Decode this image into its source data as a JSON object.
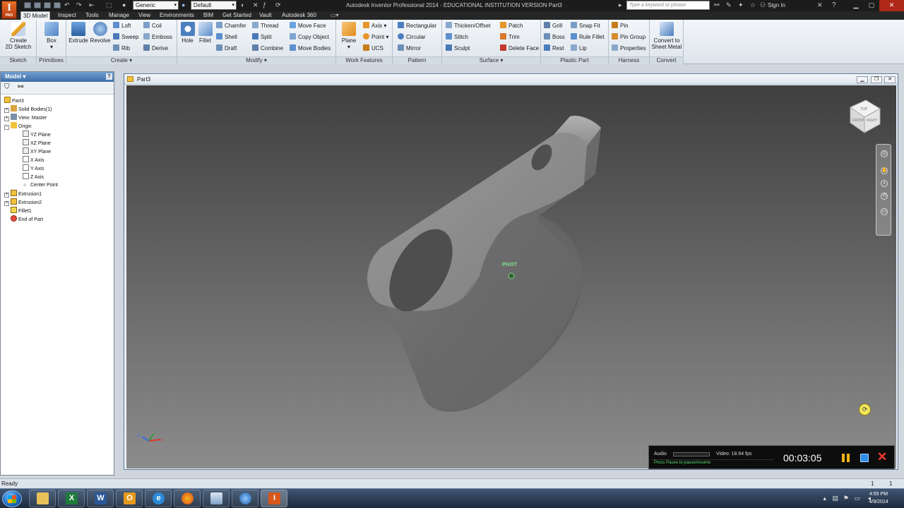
{
  "titlebar": {
    "title": "Autodesk Inventor Professional 2014 - EDUCATIONAL INSTITUTION VERSION    Part3",
    "logo_letter": "I",
    "logo_sub": "PRO",
    "material_select": "Generic",
    "appearance_select": "Default",
    "search_placeholder": "Type a keyword or phrase",
    "sign_in": "Sign In",
    "help": "?"
  },
  "tabs": [
    "3D Model",
    "Inspect",
    "Tools",
    "Manage",
    "View",
    "Environments",
    "BIM",
    "Get Started",
    "Vault",
    "Autodesk 360"
  ],
  "ribbon": {
    "sketch": {
      "title": "Sketch",
      "create_line1": "Create",
      "create_line2": "2D Sketch"
    },
    "primitives": {
      "title": "Primitives",
      "box": "Box"
    },
    "create": {
      "title": "Create",
      "extrude": "Extrude",
      "revolve": "Revolve",
      "loft": "Loft",
      "sweep": "Sweep",
      "rib": "Rib",
      "coil": "Coil",
      "emboss": "Emboss",
      "derive": "Derive"
    },
    "modify": {
      "title": "Modify",
      "hole": "Hole",
      "fillet": "Fillet",
      "chamfer": "Chamfer",
      "shell": "Shell",
      "draft": "Draft",
      "thread": "Thread",
      "split": "Split",
      "combine": "Combine",
      "move_face": "Move Face",
      "copy_object": "Copy Object",
      "move_bodies": "Move Bodies"
    },
    "work_features": {
      "title": "Work Features",
      "plane": "Plane",
      "axis": "Axis",
      "point": "Point",
      "ucs": "UCS"
    },
    "pattern": {
      "title": "Pattern",
      "rectangular": "Rectangular",
      "circular": "Circular",
      "mirror": "Mirror"
    },
    "surface": {
      "title": "Surface",
      "thicken": "Thicken/Offset",
      "stitch": "Stitch",
      "sculpt": "Sculpt",
      "patch": "Patch",
      "trim": "Trim",
      "delete_face": "Delete Face"
    },
    "plastic_part": {
      "title": "Plastic Part",
      "grill": "Grill",
      "boss": "Boss",
      "rest": "Rest",
      "snap_fit": "Snap Fit",
      "rule_fillet": "Rule Fillet",
      "lip": "Lip"
    },
    "harness": {
      "title": "Harness",
      "pin": "Pin",
      "pin_group": "Pin Group",
      "properties": "Properties"
    },
    "convert": {
      "title": "Convert",
      "line1": "Convert to",
      "line2": "Sheet Metal"
    }
  },
  "browser": {
    "title": "Model",
    "items": [
      {
        "label": "Part3",
        "icon": "part-icon"
      },
      {
        "label": "Solid Bodies(1)",
        "icon": "solid-bodies-icon"
      },
      {
        "label": "View: Master",
        "icon": "view-icon"
      },
      {
        "label": "Origin",
        "icon": "folder-icon"
      },
      {
        "label": "YZ Plane",
        "icon": "plane-icon"
      },
      {
        "label": "XZ Plane",
        "icon": "plane-icon"
      },
      {
        "label": "XY Plane",
        "icon": "plane-icon"
      },
      {
        "label": "X Axis",
        "icon": "axis-icon"
      },
      {
        "label": "Y Axis",
        "icon": "axis-icon"
      },
      {
        "label": "Z Axis",
        "icon": "axis-icon"
      },
      {
        "label": "Center Point",
        "icon": "point-icon"
      },
      {
        "label": "Extrusion1",
        "icon": "extrusion-icon"
      },
      {
        "label": "Extrusion2",
        "icon": "extrusion-icon"
      },
      {
        "label": "Fillet1",
        "icon": "fillet-icon"
      },
      {
        "label": "End of Part",
        "icon": "end-of-part-icon"
      }
    ]
  },
  "document": {
    "title": "Part3",
    "annotation": "PIVOT",
    "viewcube_faces": [
      "FRONT",
      "RIGHT",
      "TOP"
    ],
    "triad_axes": [
      "Z",
      "Y",
      "X"
    ]
  },
  "recorder": {
    "audio_label": "Audio",
    "video_label": "Video: 18.64 fps",
    "hint": "Press Pause to pause/resume",
    "time": "00:03:05"
  },
  "status": {
    "text": "Ready",
    "count_a": "1",
    "count_b": "1"
  },
  "taskbar": {
    "apps": [
      {
        "name": "explorer",
        "glyph": ""
      },
      {
        "name": "excel",
        "glyph": "X"
      },
      {
        "name": "word",
        "glyph": "W"
      },
      {
        "name": "outlook",
        "glyph": "O"
      },
      {
        "name": "internet-explorer",
        "glyph": "e"
      },
      {
        "name": "firefox",
        "glyph": ""
      },
      {
        "name": "itunes",
        "glyph": ""
      },
      {
        "name": "media",
        "glyph": ""
      },
      {
        "name": "inventor",
        "glyph": "I"
      }
    ],
    "time": "4:55 PM",
    "date": "4/9/2014"
  },
  "colors": {
    "tab_active": "#eef2f6",
    "logo": "#d9571c",
    "part_face": "#8f8f8f",
    "pivot_text": "#80e890",
    "recorder_hint": "#57d86a",
    "record_close": "#ff3b30"
  }
}
